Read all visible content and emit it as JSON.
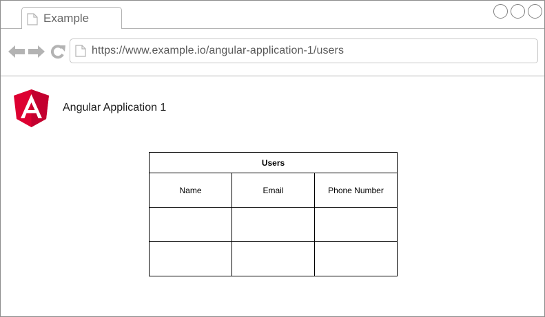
{
  "browser": {
    "tab": {
      "title": "Example",
      "icon": "document-icon"
    },
    "window_controls": [
      "minimize",
      "maximize",
      "close"
    ],
    "nav": {
      "back_icon": "arrow-left-icon",
      "forward_icon": "arrow-right-icon",
      "reload_icon": "reload-icon"
    },
    "url": "https://www.example.io/angular-application-1/users"
  },
  "app": {
    "logo": "angular-logo",
    "logo_letter": "A",
    "title": "Angular Application 1",
    "brand_color": "#c3002f"
  },
  "users_table": {
    "caption": "Users",
    "columns": [
      "Name",
      "Email",
      "Phone Number"
    ],
    "rows": [
      [
        "",
        "",
        ""
      ],
      [
        "",
        "",
        ""
      ]
    ]
  }
}
